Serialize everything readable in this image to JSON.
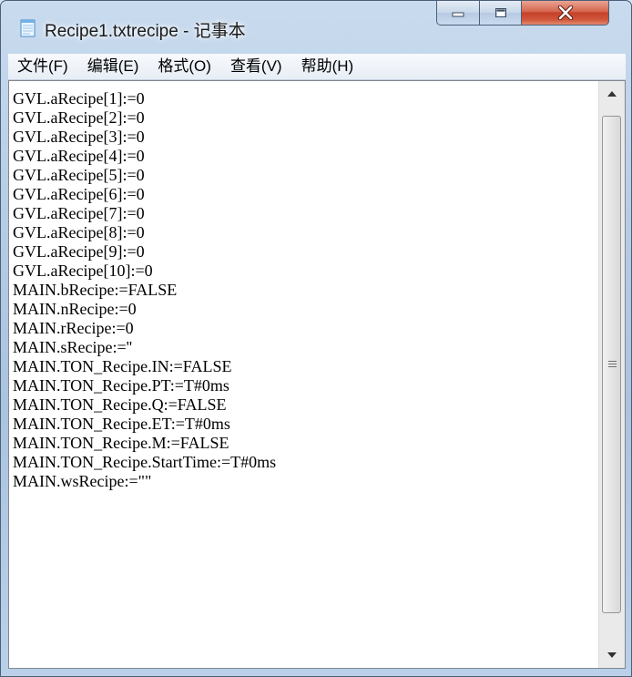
{
  "window": {
    "title": "Recipe1.txtrecipe - 记事本",
    "icon": "notepad-icon"
  },
  "caption_buttons": {
    "minimize_icon": "minimize-icon",
    "maximize_icon": "maximize-icon",
    "close_icon": "close-icon"
  },
  "menu": {
    "items": [
      {
        "label": "文件(F)"
      },
      {
        "label": "编辑(E)"
      },
      {
        "label": "格式(O)"
      },
      {
        "label": "查看(V)"
      },
      {
        "label": "帮助(H)"
      }
    ]
  },
  "content": {
    "lines": [
      "GVL.aRecipe[1]:=0",
      "GVL.aRecipe[2]:=0",
      "GVL.aRecipe[3]:=0",
      "GVL.aRecipe[4]:=0",
      "GVL.aRecipe[5]:=0",
      "GVL.aRecipe[6]:=0",
      "GVL.aRecipe[7]:=0",
      "GVL.aRecipe[8]:=0",
      "GVL.aRecipe[9]:=0",
      "GVL.aRecipe[10]:=0",
      "MAIN.bRecipe:=FALSE",
      "MAIN.nRecipe:=0",
      "MAIN.rRecipe:=0",
      "MAIN.sRecipe:=''",
      "MAIN.TON_Recipe.IN:=FALSE",
      "MAIN.TON_Recipe.PT:=T#0ms",
      "MAIN.TON_Recipe.Q:=FALSE",
      "MAIN.TON_Recipe.ET:=T#0ms",
      "MAIN.TON_Recipe.M:=FALSE",
      "MAIN.TON_Recipe.StartTime:=T#0ms",
      "MAIN.wsRecipe:=\"\""
    ]
  },
  "scrollbar": {
    "up_icon": "scroll-up-arrow-icon",
    "down_icon": "scroll-down-arrow-icon",
    "grip_icon": "scroll-grip-icon"
  }
}
